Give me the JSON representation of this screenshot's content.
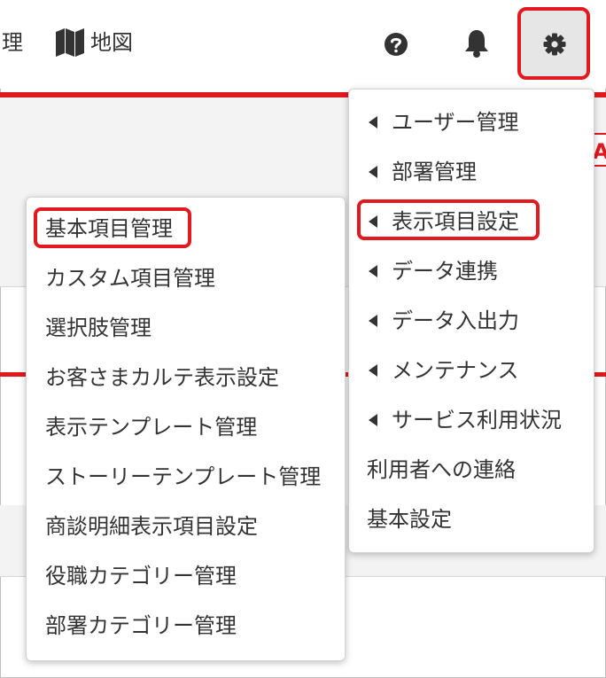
{
  "header": {
    "nav_partial_label": "理",
    "map_label": "地図",
    "icons": [
      "map-icon",
      "help-icon",
      "bell-icon",
      "gear-icon"
    ]
  },
  "background": {
    "edge_letter": "A"
  },
  "settings_menu": {
    "items": [
      {
        "label": "ユーザー管理",
        "submenu": true
      },
      {
        "label": "部署管理",
        "submenu": true
      },
      {
        "label": "表示項目設定",
        "submenu": true,
        "highlighted": true
      },
      {
        "label": "データ連携",
        "submenu": true
      },
      {
        "label": "データ入出力",
        "submenu": true
      },
      {
        "label": "メンテナンス",
        "submenu": true
      },
      {
        "label": "サービス利用状況",
        "submenu": true
      },
      {
        "label": "利用者への連絡",
        "submenu": false
      },
      {
        "label": "基本設定",
        "submenu": false
      }
    ]
  },
  "submenu": {
    "items": [
      {
        "label": "基本項目管理",
        "highlighted": true
      },
      {
        "label": "カスタム項目管理"
      },
      {
        "label": "選択肢管理"
      },
      {
        "label": "お客さまカルテ表示設定"
      },
      {
        "label": "表示テンプレート管理"
      },
      {
        "label": "ストーリーテンプレート管理"
      },
      {
        "label": "商談明細表示項目設定"
      },
      {
        "label": "役職カテゴリー管理"
      },
      {
        "label": "部署カテゴリー管理"
      }
    ]
  },
  "colors": {
    "accent_red": "#e0191f",
    "highlight_red": "#e11a20",
    "text": "#333333"
  }
}
